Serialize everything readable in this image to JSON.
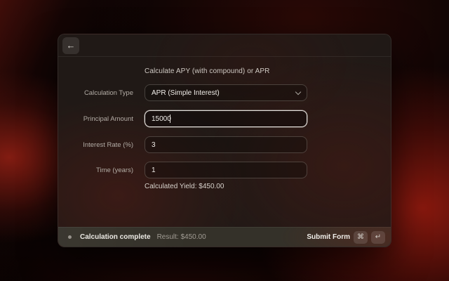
{
  "window": {
    "back_icon_glyph": "←"
  },
  "form": {
    "title": "Calculate APY (with compound) or APR",
    "fields": [
      {
        "label": "Calculation Type",
        "type": "select",
        "value": "APR (Simple Interest)"
      },
      {
        "label": "Principal Amount",
        "type": "text",
        "value": "15000",
        "focused": true
      },
      {
        "label": "Interest Rate (%)",
        "type": "text",
        "value": "3"
      },
      {
        "label": "Time (years)",
        "type": "text",
        "value": "1"
      }
    ],
    "result_text": "Calculated Yield: $450.00"
  },
  "footer": {
    "status": "Calculation complete",
    "result": "Result: $450.00",
    "submit_label": "Submit Form",
    "shortcut_keys": [
      "⌘",
      "↵"
    ]
  },
  "colors": {
    "background_glow": "#9e1c10",
    "window_bg": "#211a17",
    "footer_bg": "#343129",
    "focus_border": "#f8f5f1",
    "text_primary": "#f0ede9",
    "text_muted": "#a09b93"
  }
}
